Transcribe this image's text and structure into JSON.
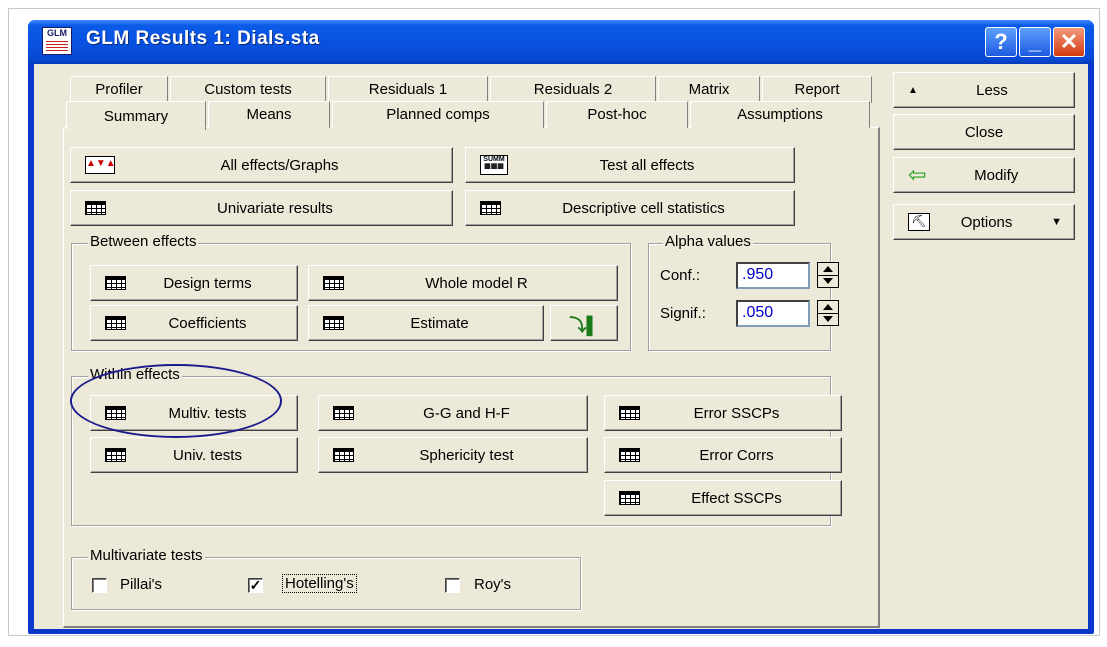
{
  "window": {
    "title": "GLM Results 1: Dials.sta",
    "icon_text": "GLM"
  },
  "caption_buttons": {
    "help": "?",
    "minimize": "_",
    "close": "✕"
  },
  "tabs_row1": [
    "Profiler",
    "Custom tests",
    "Residuals 1",
    "Residuals 2",
    "Matrix",
    "Report"
  ],
  "tabs_row2": [
    "Summary",
    "Means",
    "Planned comps",
    "Post-hoc",
    "Assumptions"
  ],
  "top_buttons": {
    "all_effects": "All effects/Graphs",
    "test_all": "Test all effects",
    "univariate": "Univariate results",
    "descriptive": "Descriptive cell statistics"
  },
  "between_effects": {
    "legend": "Between effects",
    "design_terms": "Design terms",
    "whole_model": "Whole model R",
    "coefficients": "Coefficients",
    "estimate": "Estimate"
  },
  "alpha_values": {
    "legend": "Alpha values",
    "conf_label": "Conf.:",
    "conf_value": ".950",
    "signif_label": "Signif.:",
    "signif_value": ".050"
  },
  "within_effects": {
    "legend": "Within effects",
    "multiv_tests": "Multiv. tests",
    "gg_hf": "G-G and H-F",
    "error_sscps": "Error SSCPs",
    "univ_tests": "Univ. tests",
    "sphericity": "Sphericity test",
    "error_corrs": "Error Corrs",
    "effect_sscps": "Effect SSCPs"
  },
  "multivariate_tests": {
    "legend": "Multivariate tests",
    "options": [
      {
        "label": "Pillai's",
        "checked": false
      },
      {
        "label": "Hotelling's",
        "checked": true
      },
      {
        "label": "Roy's",
        "checked": false
      }
    ]
  },
  "side_buttons": {
    "less": "Less",
    "close": "Close",
    "modify": "Modify",
    "options": "Options"
  }
}
